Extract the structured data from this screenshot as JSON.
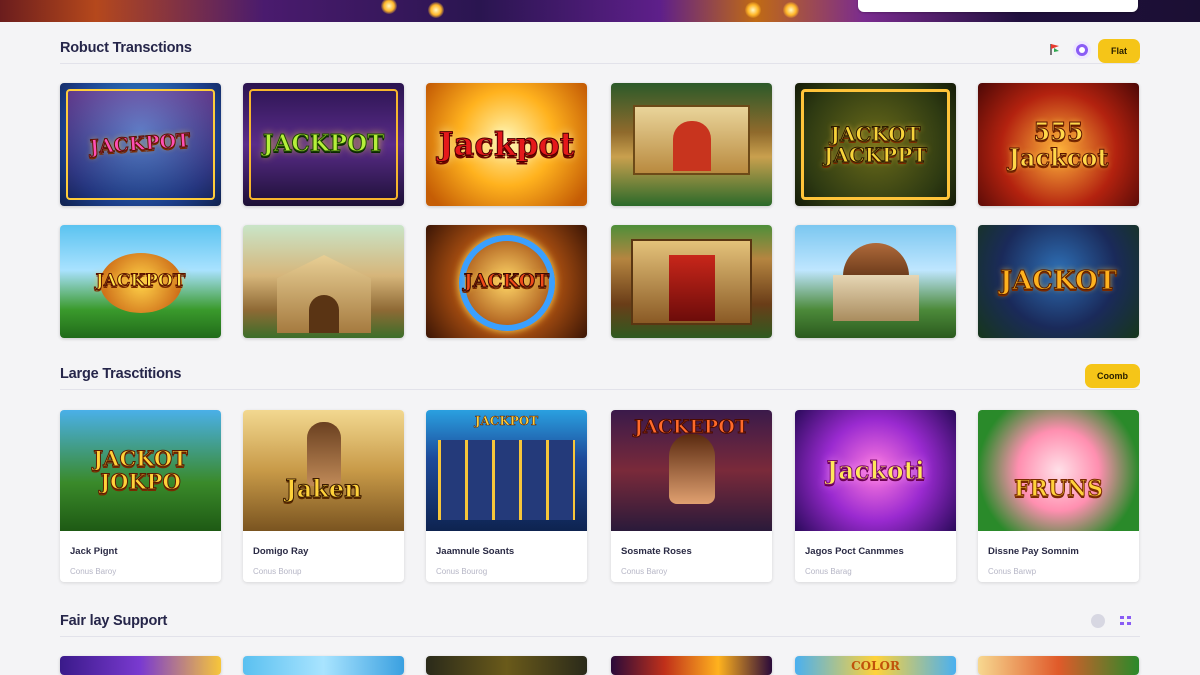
{
  "header": {
    "search_placeholder": ""
  },
  "sections": [
    {
      "title": "Robuct Transctions",
      "action_label": "Flat",
      "tiles_row1": [
        {
          "label": "JACKPOT",
          "theme": "slot-machine"
        },
        {
          "label": "JACKPOT",
          "theme": "purple-marquee"
        },
        {
          "label": "Jackpot",
          "theme": "golden-burst"
        },
        {
          "label": "",
          "theme": "temple-stage"
        },
        {
          "label": "JACKOT JACKPPT",
          "theme": "gold-sign"
        },
        {
          "label": "555 Jackcot",
          "theme": "red-curtain"
        }
      ],
      "tiles_row2": [
        {
          "label": "JACKPOT",
          "theme": "tropical-coins"
        },
        {
          "label": "",
          "theme": "jungle-palace"
        },
        {
          "label": "JACKOT",
          "theme": "wheel"
        },
        {
          "label": "",
          "theme": "casino-building"
        },
        {
          "label": "",
          "theme": "tropical-dome"
        },
        {
          "label": "JACKOT",
          "theme": "night-jungle"
        }
      ]
    },
    {
      "title": "Large Trasctitions",
      "action_label": "Coomb",
      "cards": [
        {
          "title": "Jack Pignt",
          "meta": "Conus Baroy",
          "art": "JACKOT JOKPO"
        },
        {
          "title": "Domigo Ray",
          "meta": "Conus Bonup",
          "art": "Jaken"
        },
        {
          "title": "Jaamnule Soants",
          "meta": "Conus Bourog",
          "art": "JACKPOT"
        },
        {
          "title": "Sosmate Roses",
          "meta": "Conus Baroy",
          "art": "JACKEPOT"
        },
        {
          "title": "Jagos Poct Canmmes",
          "meta": "Conus Barag",
          "art": "Jackoti"
        },
        {
          "title": "Dissne Pay Somnim",
          "meta": "Conus Barwp",
          "art": "FRUNS"
        }
      ]
    },
    {
      "title": "Fair lay Support",
      "tiles": [
        {
          "label": "",
          "theme": "purple"
        },
        {
          "label": "",
          "theme": "sky"
        },
        {
          "label": "",
          "theme": "dark-gold"
        },
        {
          "label": "",
          "theme": "red-gold"
        },
        {
          "label": "COLOR",
          "theme": "blue-yellow"
        },
        {
          "label": "",
          "theme": "jungle-red"
        }
      ]
    }
  ],
  "icons": {
    "flag": "flag-icon",
    "avatar": "profile-icon",
    "circle": "circle-icon",
    "grid": "grid-icon"
  },
  "colors": {
    "accent": "#f5c518",
    "title": "#26264a"
  }
}
